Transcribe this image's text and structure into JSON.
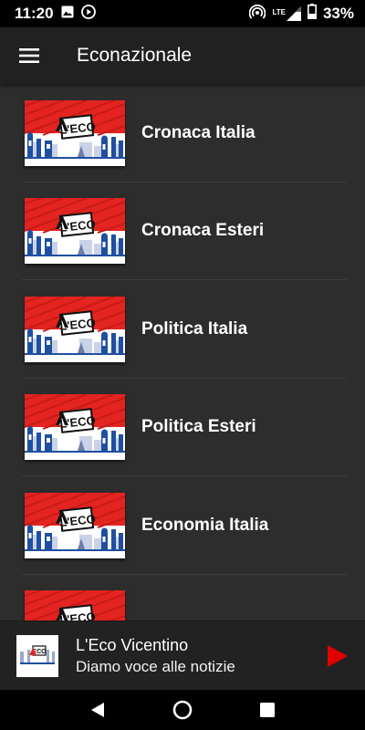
{
  "status_bar": {
    "time": "11:20",
    "network": "LTE",
    "battery": "33%"
  },
  "app_bar": {
    "title": "Econazionale",
    "menu_icon": "hamburger-menu-icon"
  },
  "list": {
    "items": [
      {
        "title": "Cronaca Italia"
      },
      {
        "title": "Cronaca Esteri"
      },
      {
        "title": "Politica Italia"
      },
      {
        "title": "Politica Esteri"
      },
      {
        "title": "Economia Italia"
      },
      {
        "title": ""
      }
    ],
    "logo_text": "L'ECO"
  },
  "player": {
    "title": "L'Eco Vicentino",
    "subtitle": "Diamo voce alle notizie",
    "play_icon": "play-icon",
    "accent_color": "#e00000"
  },
  "colors": {
    "background": "#2d2d2d",
    "app_bar": "#212121",
    "logo_red": "#e32420",
    "logo_blue": "#1f4fa0"
  }
}
